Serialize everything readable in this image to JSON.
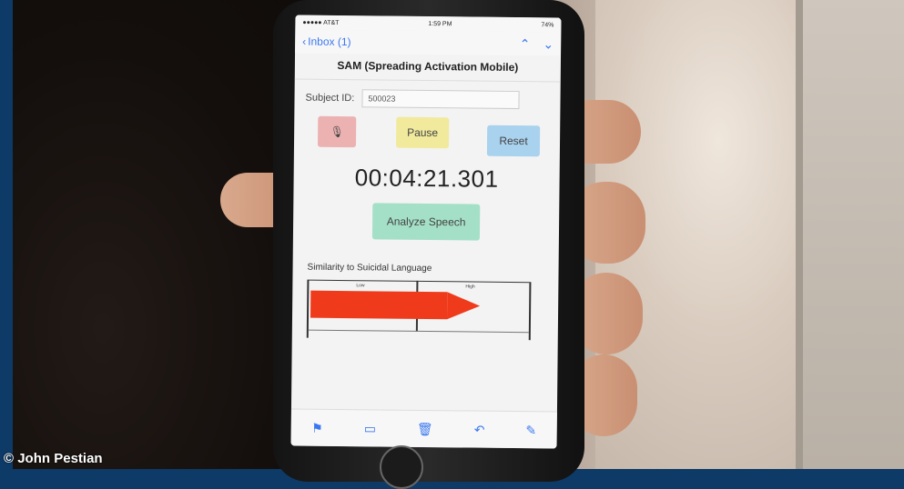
{
  "photo_credit": "© John Pestian",
  "status_bar": {
    "carrier": "●●●●● AT&T",
    "time": "1:59 PM",
    "battery": "74%"
  },
  "nav": {
    "back_label": "Inbox (1)",
    "up_icon": "chevron-up-icon",
    "down_icon": "chevron-down-icon"
  },
  "app": {
    "title": "SAM (Spreading Activation Mobile)",
    "subject_label": "Subject ID:",
    "subject_value": "500023",
    "mic_icon": "microphone-icon",
    "pause_label": "Pause",
    "reset_label": "Reset",
    "timer": "00:04:21.301",
    "analyze_label": "Analyze Speech",
    "similarity_label": "Similarity to Suicidal Language",
    "gauge": {
      "low_label": "Low",
      "high_label": "High",
      "level": 0.78
    }
  },
  "toolbar_icons": [
    "flag-icon",
    "folder-icon",
    "trash-icon",
    "reply-icon",
    "compose-icon"
  ],
  "colors": {
    "mic": "#ecb2b2",
    "pause": "#f1ea9d",
    "reset": "#a9d2ee",
    "analyze": "#a4e0c7",
    "gauge_bar": "#ef3b1c",
    "ios_blue": "#3a78f2"
  }
}
